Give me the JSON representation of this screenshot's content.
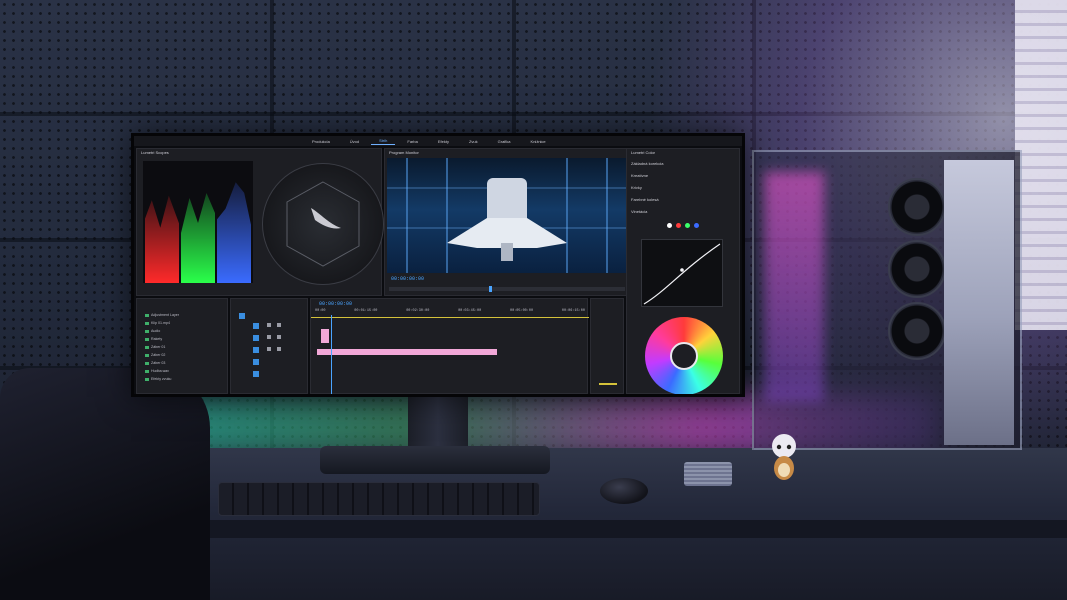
{
  "scene": {
    "description_free": true
  },
  "premiere": {
    "workspace_tabs": [
      "Produkcia",
      "Úvod",
      "Strih",
      "Farba",
      "Efekty",
      "Zvuk",
      "Grafika",
      "Knižnice"
    ],
    "active_workspace_index": 2,
    "scopes_pane_title": "Lumetri Scopes",
    "program_title": "Program Monitor",
    "program_timecode": "00:00:00:00",
    "lumetri_title": "Lumetri Color",
    "lumetri_rows": [
      "Základná korekcia",
      "Kreatívne",
      "Krivky",
      "Farebné kolesá",
      "Vinetácia"
    ],
    "timeline_timecode": "00:00:00:00",
    "timecode_color": "#4aa4ff",
    "timeline_rulers": [
      "00:00",
      "00:01:15:00",
      "00:02:30:00",
      "00:03:45:00",
      "00:05:00:00",
      "00:06:15:00"
    ],
    "project_items": [
      "Adjustment Layer",
      "Klip 01.mp4",
      "Audio",
      "Rakety",
      "Záber 01",
      "Záber 02",
      "Záber 03",
      "Hudba.wav",
      "Efekty zvuku"
    ],
    "wheel_swatch_colors": [
      "#ff3b3b",
      "#ffd23b",
      "#58ff3b",
      "#3bffe6",
      "#3b6bff",
      "#c23bff"
    ]
  },
  "colors": {
    "accent_teal": "#2adcc0",
    "accent_magenta": "#e650dc",
    "accent_violet": "#a05aff",
    "clip_pink": "#f2a8d8"
  }
}
